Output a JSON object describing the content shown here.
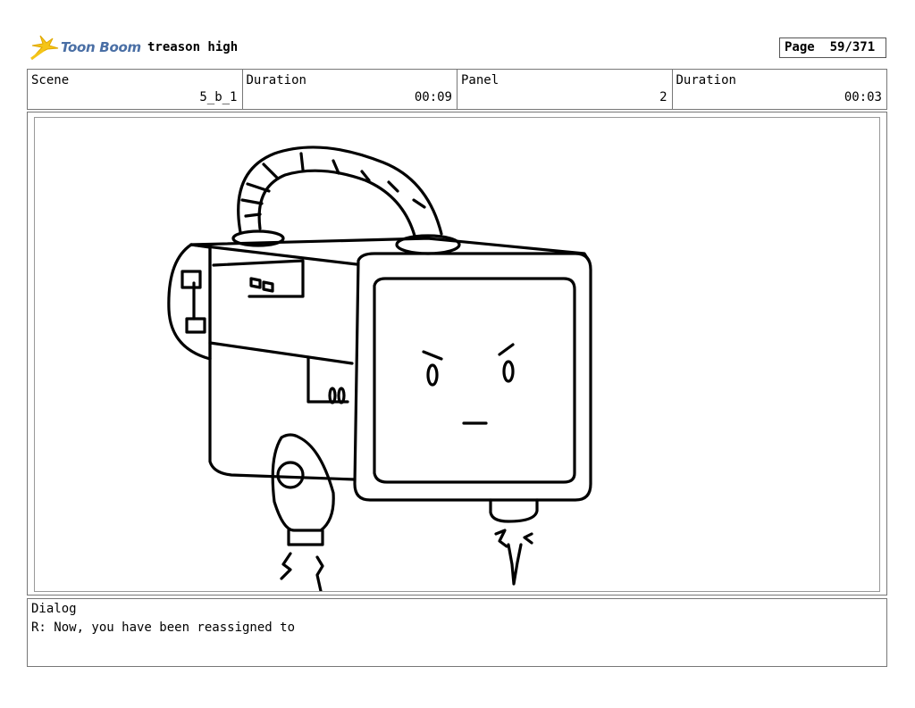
{
  "header": {
    "logo_text": "Toon Boom",
    "project_title": "treason high",
    "page_label": "Page",
    "page_value": "59/371"
  },
  "info": {
    "scene_label": "Scene",
    "scene_value": "5_b_1",
    "scene_duration_label": "Duration",
    "scene_duration_value": "00:09",
    "panel_label": "Panel",
    "panel_value": "2",
    "panel_duration_label": "Duration",
    "panel_duration_value": "00:03"
  },
  "panel": {
    "drawing": "robot-tv-character-sketch"
  },
  "dialog": {
    "label": "Dialog",
    "text": "R: Now, you have been reassigned to"
  }
}
